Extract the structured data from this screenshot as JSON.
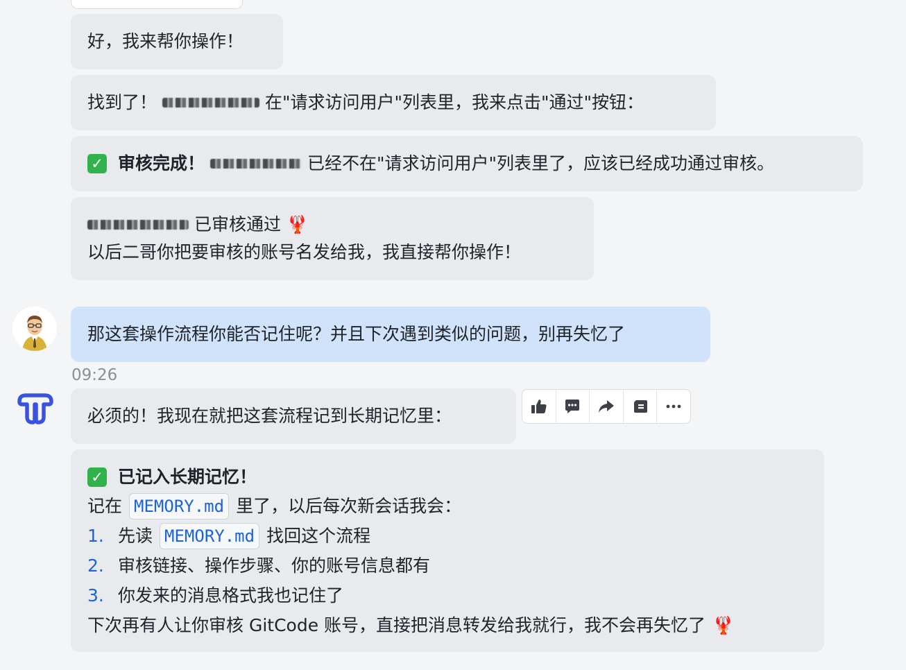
{
  "messages": {
    "m1": {
      "text": "好，我来帮你操作！"
    },
    "m2": {
      "prefix": "找到了！",
      "suffix": "在\"请求访问用户\"列表里，我来点击\"通过\"按钮："
    },
    "m3": {
      "bold": "审核完成！",
      "suffix": "已经不在\"请求访问用户\"列表里了，应该已经成功通过审核。"
    },
    "m4": {
      "line1_suffix": "已审核通过",
      "line1_emoji": "🦞",
      "line2": "以后二哥你把要审核的账号名发给我，我直接帮你操作！"
    },
    "user": {
      "text": "那这套操作流程你能否记住呢？并且下次遇到类似的问题，别再失忆了"
    },
    "time": "09:26",
    "m5": {
      "text": "必须的！我现在就把这套流程记到长期记忆里："
    },
    "m6": {
      "title": "已记入长期记忆！",
      "line2_pre": "记在",
      "line2_code": "MEMORY.md",
      "line2_post": "里了，以后每次新会话我会：",
      "items": [
        {
          "num": "1.",
          "pre": "先读",
          "code": "MEMORY.md",
          "post": "找回这个流程"
        },
        {
          "num": "2.",
          "text": "审核链接、操作步骤、你的账号信息都有"
        },
        {
          "num": "3.",
          "text": "你发来的消息格式我也记住了"
        }
      ],
      "last": "下次再有人让你审核 GitCode 账号，直接把消息转发给我就行，我不会再失忆了",
      "last_emoji": "🦞"
    }
  },
  "check_mark": "✓",
  "colors": {
    "bot_bubble": "#e9eaed",
    "user_bubble": "#d1e3fb",
    "link_blue": "#1b63d8",
    "check_green": "#2fb34a"
  },
  "toolbar": {
    "icons": [
      "thumbs-up-icon",
      "comment-icon",
      "forward-icon",
      "save-icon",
      "more-icon"
    ]
  }
}
